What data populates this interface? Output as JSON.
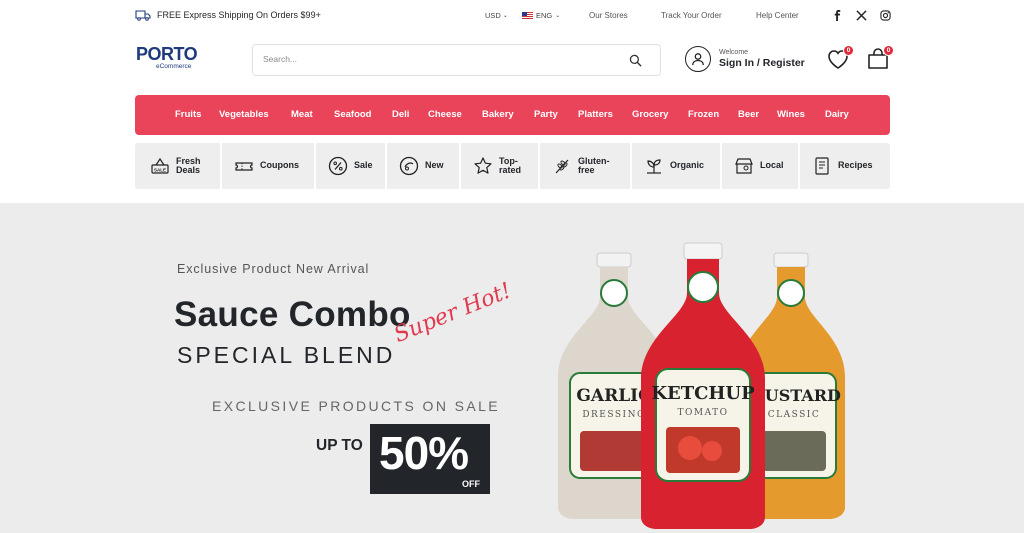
{
  "topbar": {
    "shipping_text": "FREE Express Shipping On Orders $99+",
    "currency": "USD",
    "language": "ENG",
    "links": [
      "Our Stores",
      "Track Your Order",
      "Help Center"
    ]
  },
  "header": {
    "logo_main": "PORTO",
    "logo_sub": "eCommerce",
    "search_placeholder": "Search...",
    "welcome": "Welcome",
    "signin": "Sign In / Register",
    "wishlist_count": "0",
    "cart_count": "0"
  },
  "categories": [
    "Fruits",
    "Vegetables",
    "Meat",
    "Seafood",
    "Deli",
    "Cheese",
    "Bakery",
    "Party",
    "Platters",
    "Grocery",
    "Frozen",
    "Beer",
    "Wines",
    "Dairy"
  ],
  "features": [
    {
      "label": "Fresh Deals",
      "icon": "sale-tag-icon"
    },
    {
      "label": "Coupons",
      "icon": "coupon-icon"
    },
    {
      "label": "Sale",
      "icon": "percent-icon"
    },
    {
      "label": "New",
      "icon": "new-badge-icon"
    },
    {
      "label": "Top-rated",
      "icon": "star-icon"
    },
    {
      "label": "Gluten-free",
      "icon": "wheat-icon"
    },
    {
      "label": "Organic",
      "icon": "plant-icon"
    },
    {
      "label": "Local",
      "icon": "store-location-icon"
    },
    {
      "label": "Recipes",
      "icon": "recipe-book-icon"
    }
  ],
  "hero": {
    "kicker": "Exclusive Product New Arrival",
    "title": "Sauce Combo",
    "subtitle": "SPECIAL BLEND",
    "script": "Super Hot!",
    "line": "EXCLUSIVE PRODUCTS ON SALE",
    "upto": "UP TO",
    "percent": "50%",
    "off": "OFF",
    "bottle_labels": [
      "GARLIC",
      "DRESSING",
      "KETCHUP",
      "TOMATO",
      "MUSTARD",
      "CLASSIC"
    ]
  },
  "colors": {
    "brand_blue": "#1e3a7b",
    "accent_red": "#e9445a",
    "dark": "#222529"
  }
}
